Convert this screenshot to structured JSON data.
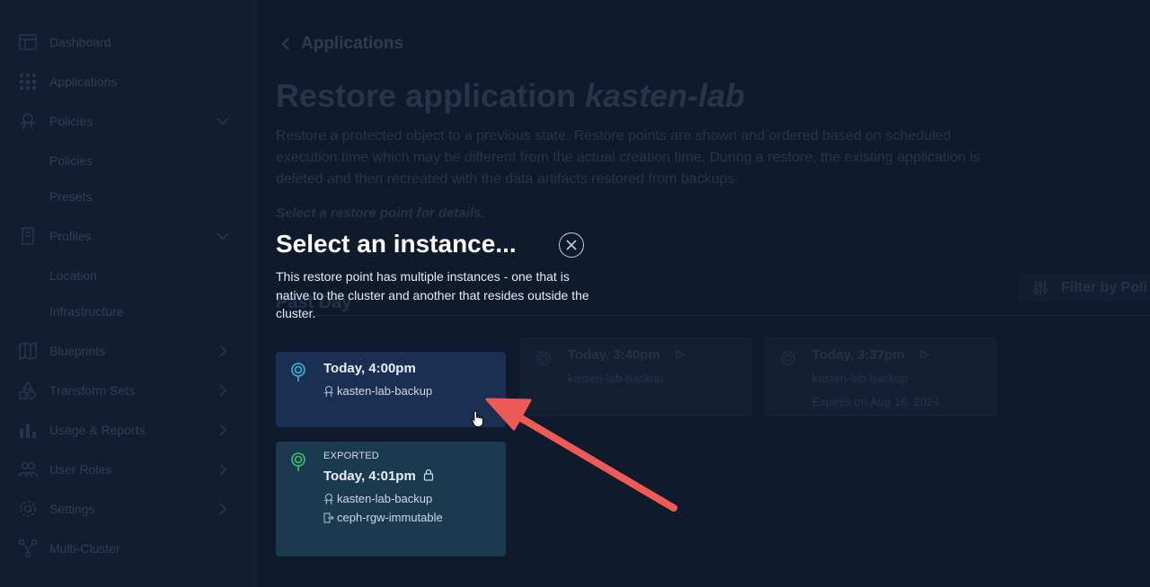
{
  "sidebar": {
    "items": [
      {
        "label": "Dashboard",
        "icon": "dashboard-icon"
      },
      {
        "label": "Applications",
        "icon": "grid-icon"
      },
      {
        "label": "Policies",
        "icon": "policies-icon"
      },
      {
        "label": "Profiles",
        "icon": "profiles-icon"
      },
      {
        "label": "Blueprints",
        "icon": "map-icon"
      },
      {
        "label": "Transform Sets",
        "icon": "transform-icon"
      },
      {
        "label": "Usage & Reports",
        "icon": "chart-icon"
      },
      {
        "label": "User Roles",
        "icon": "users-icon"
      },
      {
        "label": "Settings",
        "icon": "gear-icon"
      },
      {
        "label": "Multi-Cluster",
        "icon": "multicluster-icon"
      }
    ],
    "policies_sub": [
      "Policies",
      "Presets"
    ],
    "profiles_sub": [
      "Location",
      "Infrastructure"
    ]
  },
  "main": {
    "back_label": "Applications",
    "title_prefix": "Restore application ",
    "title_app": "kasten-lab",
    "description": "Restore a protected object to a previous state. Restore points are shown and ordered based on scheduled execution time which may be different from the actual creation time. During a restore, the existing application is deleted and then recreated with the data artifacts restored from backups.",
    "hint": "Select a restore point for details.",
    "section_title": "Past Day",
    "filter_label": "Filter by Poli",
    "cards": [
      {
        "time": "Today, 3:40pm",
        "name": "kasten-lab-backup",
        "expires": ""
      },
      {
        "time": "Today, 3:37pm",
        "name": "kasten-lab-backup",
        "expires": "Expires on Aug 16, 2024"
      }
    ]
  },
  "modal": {
    "title": "Select an instance...",
    "description": "This restore point has multiple instances - one that is native to the cluster and another that resides outside the cluster.",
    "instances": [
      {
        "tag": "",
        "time": "Today, 4:00pm",
        "name": "kasten-lab-backup",
        "location": ""
      },
      {
        "tag": "EXPORTED",
        "time": "Today, 4:01pm",
        "name": "kasten-lab-backup",
        "location": "ceph-rgw-immutable"
      }
    ]
  },
  "colors": {
    "native_pin": "#3fb5d9",
    "exported_pin": "#39c46a",
    "arrow": "#ee5a55"
  }
}
